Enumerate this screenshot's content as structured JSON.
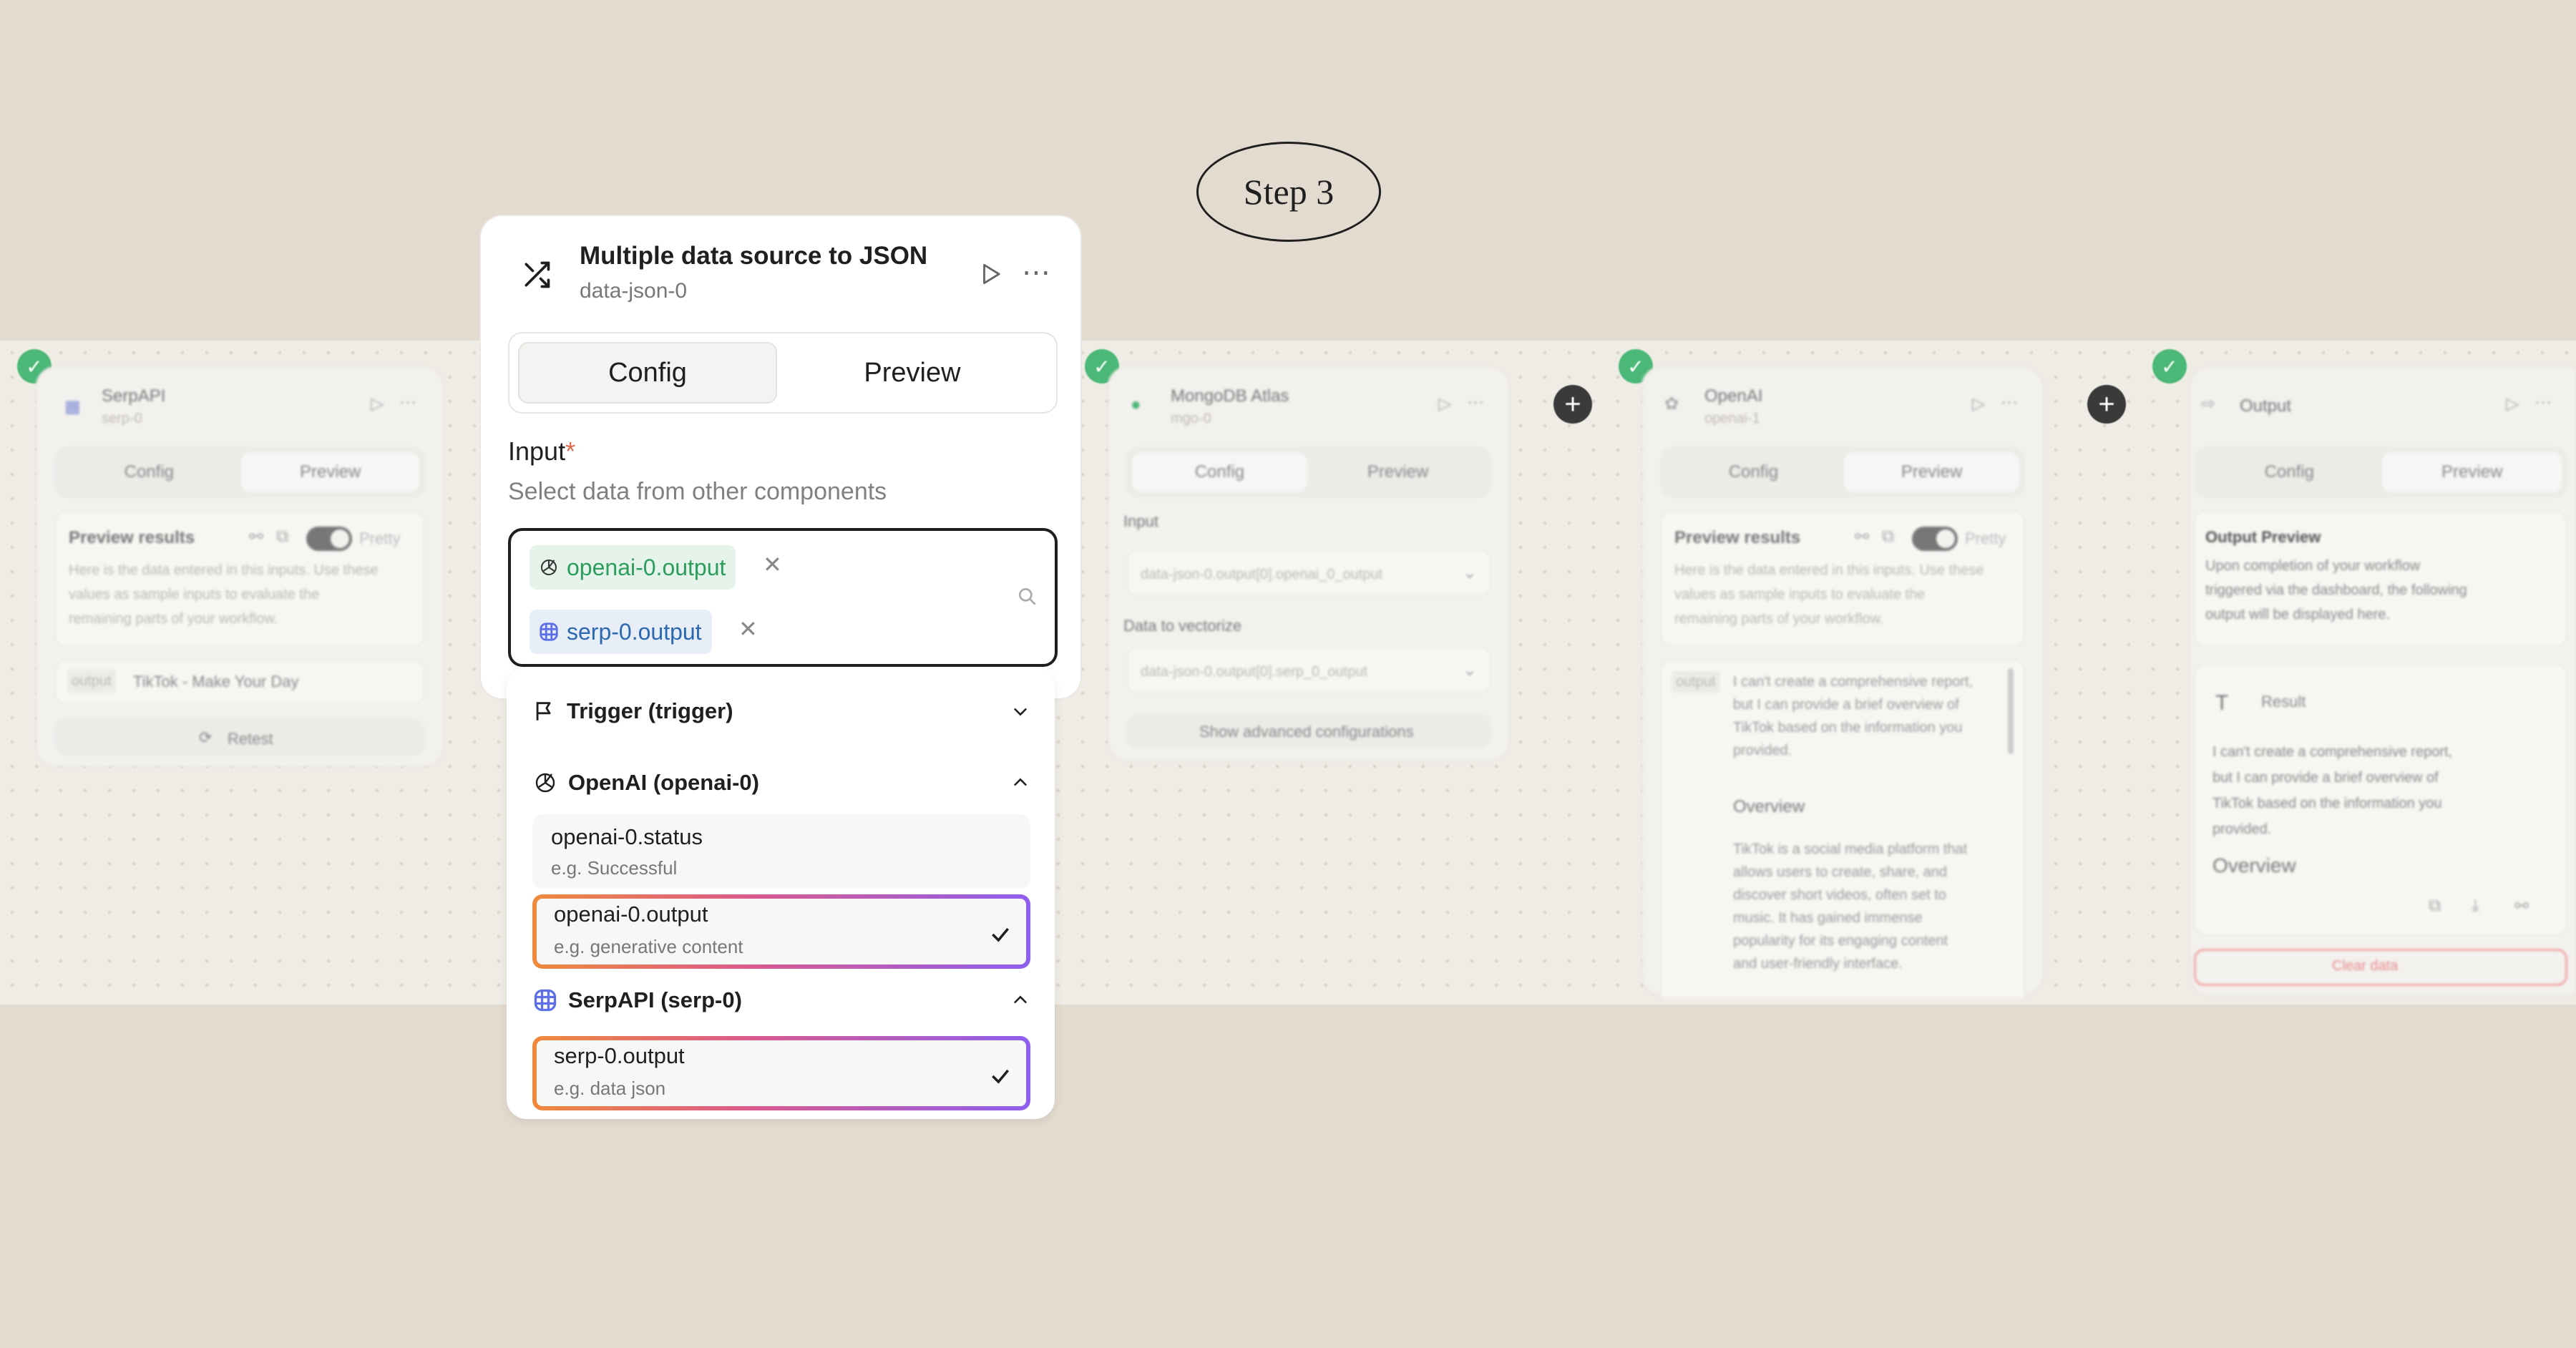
{
  "step_label": "Step 3",
  "colors": {
    "background": "#e4dbd0",
    "success_green": "#4bb877",
    "selection_gradient": [
      "#ef8a3c",
      "#d85a8f",
      "#8e5ff0"
    ],
    "chip_green": "#2d9d5c",
    "chip_blue": "#2c68b0"
  },
  "panel": {
    "icon": "shuffle-icon",
    "title": "Multiple data source to JSON",
    "id": "data-json-0",
    "tabs": [
      "Config",
      "Preview"
    ],
    "input_label": "Input",
    "required_mark": "*",
    "input_hint": "Select data from other components",
    "chips": [
      {
        "label": "openai-0.output",
        "icon": "openai-icon"
      },
      {
        "label": "serp-0.output",
        "icon": "serpapi-icon"
      }
    ]
  },
  "dropdown": {
    "groups": [
      {
        "label": "Trigger (trigger)",
        "icon": "flag-icon",
        "expanded": false
      },
      {
        "label": "OpenAI (openai-0)",
        "icon": "openai-icon",
        "expanded": true,
        "options": [
          {
            "title": "openai-0.status",
            "example": "e.g. Successful",
            "selected": false
          },
          {
            "title": "openai-0.output",
            "example": "e.g. generative content",
            "selected": true
          }
        ]
      },
      {
        "label": "SerpAPI (serp-0)",
        "icon": "serpapi-icon",
        "expanded": true,
        "options": [
          {
            "title": "serp-0.output",
            "example": "e.g. data json",
            "selected": true
          }
        ]
      }
    ]
  },
  "bg_nodes": {
    "serp": {
      "title": "SerpAPI",
      "id": "serp-0",
      "tabs": [
        "Config",
        "Preview"
      ],
      "preview_title": "Preview results",
      "pretty": "Pretty",
      "preview_desc": [
        "Here is the data entered in this inputs. Use these",
        "values as sample inputs to evaluate the",
        "remaining parts of your workflow."
      ],
      "output_tag": "output",
      "output_value": "TikTok - Make Your Day",
      "retest": "Retest"
    },
    "mongo": {
      "title": "MongoDB Atlas",
      "id": "mgo-0",
      "tabs": [
        "Config",
        "Preview"
      ],
      "input_label": "Input",
      "input_value": "data-json-0.output[0].openai_0_output",
      "vector_label": "Data to vectorize",
      "vector_value": "data-json-0.output[0].serp_0_output",
      "advanced": "Show advanced configurations"
    },
    "openai": {
      "title": "OpenAI",
      "id": "openai-1",
      "tabs": [
        "Config",
        "Preview"
      ],
      "preview_title": "Preview results",
      "pretty": "Pretty",
      "preview_desc": [
        "Here is the data entered in this inputs. Use these",
        "values as sample inputs to evaluate the",
        "remaining parts of your workflow."
      ],
      "output_tag": "output",
      "output_lines": [
        "I can't create a comprehensive report,",
        "but I can provide a brief overview of",
        "TikTok based on the information you",
        "provided."
      ],
      "overview": "Overview",
      "overview_lines": [
        "TikTok is a social media platform that",
        "allows users to create, share, and",
        "discover short videos, often set to",
        "music. It has gained immense",
        "popularity for its engaging content",
        "and user-friendly interface."
      ]
    },
    "output": {
      "title": "Output",
      "tabs": [
        "Config",
        "Preview"
      ],
      "preview_title": "Output Preview",
      "preview_desc": [
        "Upon completion of your workflow",
        "triggered via the dashboard, the following",
        "output will be displayed here."
      ],
      "result_label": "Result",
      "result_lines": [
        "I can't create a comprehensive report,",
        "but I can provide a brief overview of",
        "TikTok based on the information you",
        "provided."
      ],
      "overview": "Overview",
      "clear": "Clear data"
    }
  }
}
